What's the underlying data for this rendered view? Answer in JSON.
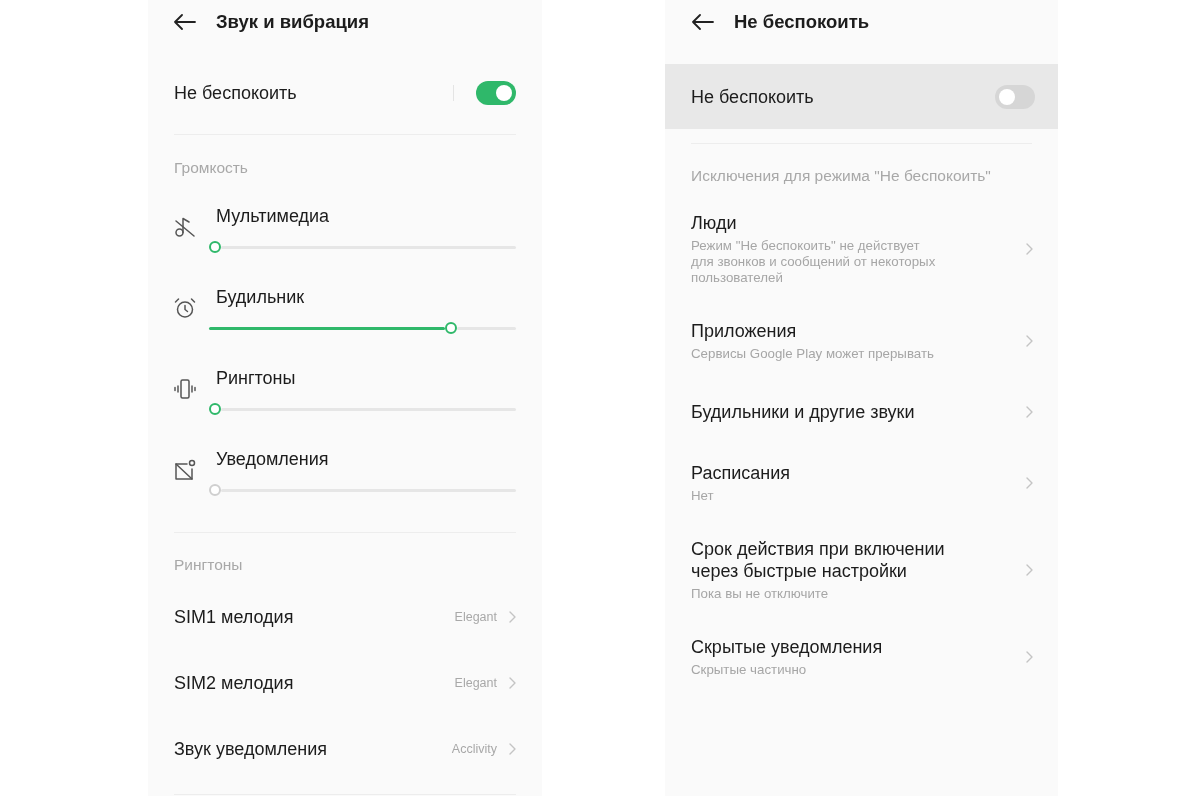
{
  "sound_screen": {
    "title": "Звук и вибрация",
    "do_not_disturb": {
      "label": "Не беспокоить",
      "on": true
    },
    "volume": {
      "heading": "Громкость",
      "sliders": [
        {
          "label": "Мультимедиа",
          "level": 0,
          "disabled": false
        },
        {
          "label": "Будильник",
          "level": 0.8,
          "disabled": false
        },
        {
          "label": "Рингтоны",
          "level": 0,
          "disabled": false
        },
        {
          "label": "Уведомления",
          "level": 0,
          "disabled": true
        }
      ]
    },
    "ringtones": {
      "heading": "Рингтоны",
      "items": [
        {
          "label": "SIM1 мелодия",
          "value": "Elegant"
        },
        {
          "label": "SIM2 мелодия",
          "value": "Elegant"
        },
        {
          "label": "Звук уведомления",
          "value": "Acclivity"
        }
      ]
    }
  },
  "dnd_screen": {
    "title": "Не беспокоить",
    "do_not_disturb": {
      "label": "Не беспокоить",
      "on": false,
      "highlighted": true
    },
    "exceptions": {
      "heading": "Исключения для режима \"Не беспокоить\"",
      "items": [
        {
          "title": "Люди",
          "subtitle": "Режим \"Не беспокоить\" не действует для звонков и сообщений от некоторых пользователей"
        },
        {
          "title": "Приложения",
          "subtitle": "Сервисы Google Play может прерывать"
        },
        {
          "title": "Будильники и другие звуки"
        },
        {
          "title": "Расписания",
          "subtitle": "Нет"
        },
        {
          "title": "Срок действия при включении через быстрые настройки",
          "subtitle": "Пока вы не отключите"
        },
        {
          "title": "Скрытые уведомления",
          "subtitle": "Скрытые частично"
        }
      ]
    }
  }
}
